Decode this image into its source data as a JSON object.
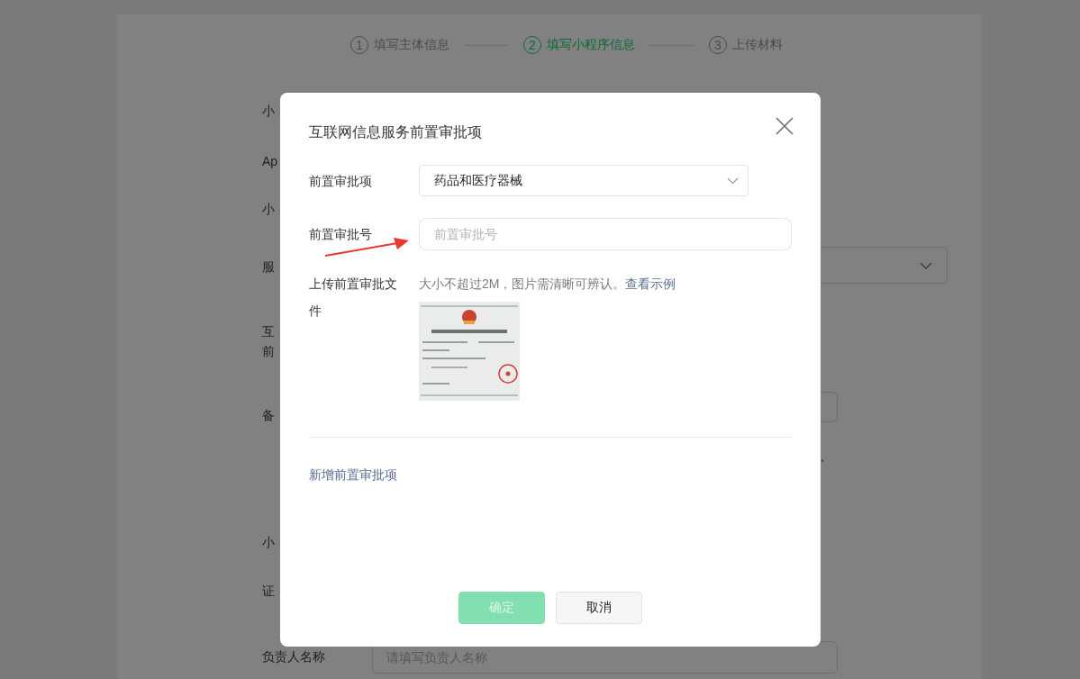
{
  "background_page": {
    "steps": [
      {
        "number": "1",
        "label": "填写主体信息",
        "selected": false
      },
      {
        "number": "2",
        "label": "填写小程序信息",
        "selected": true
      },
      {
        "number": "3",
        "label": "上传材料",
        "selected": false
      }
    ],
    "form_labels": [
      "小",
      "Ap",
      "小",
      "服",
      "互",
      "前",
      "备",
      "小",
      "证"
    ],
    "trailing_text": "，",
    "manager_name": {
      "label": "负责人名称",
      "placeholder": "请填写负责人名称"
    }
  },
  "dialog": {
    "title": "互联网信息服务前置审批项",
    "fields": [
      {
        "kind": "select",
        "label": "前置审批项",
        "value": "药品和医疗器械"
      },
      {
        "kind": "input",
        "label": "前置审批号",
        "placeholder": "前置审批号"
      },
      {
        "kind": "upload",
        "label": "上传前置审批文件",
        "hint": "大小不超过2M，图片需清晰可辨认。",
        "link": "查看示例"
      }
    ],
    "add_link": "新增前置审批项",
    "buttons": [
      {
        "label": "确定",
        "kind": "primary",
        "disabled": true
      },
      {
        "label": "取消",
        "kind": "default",
        "disabled": false
      }
    ]
  }
}
